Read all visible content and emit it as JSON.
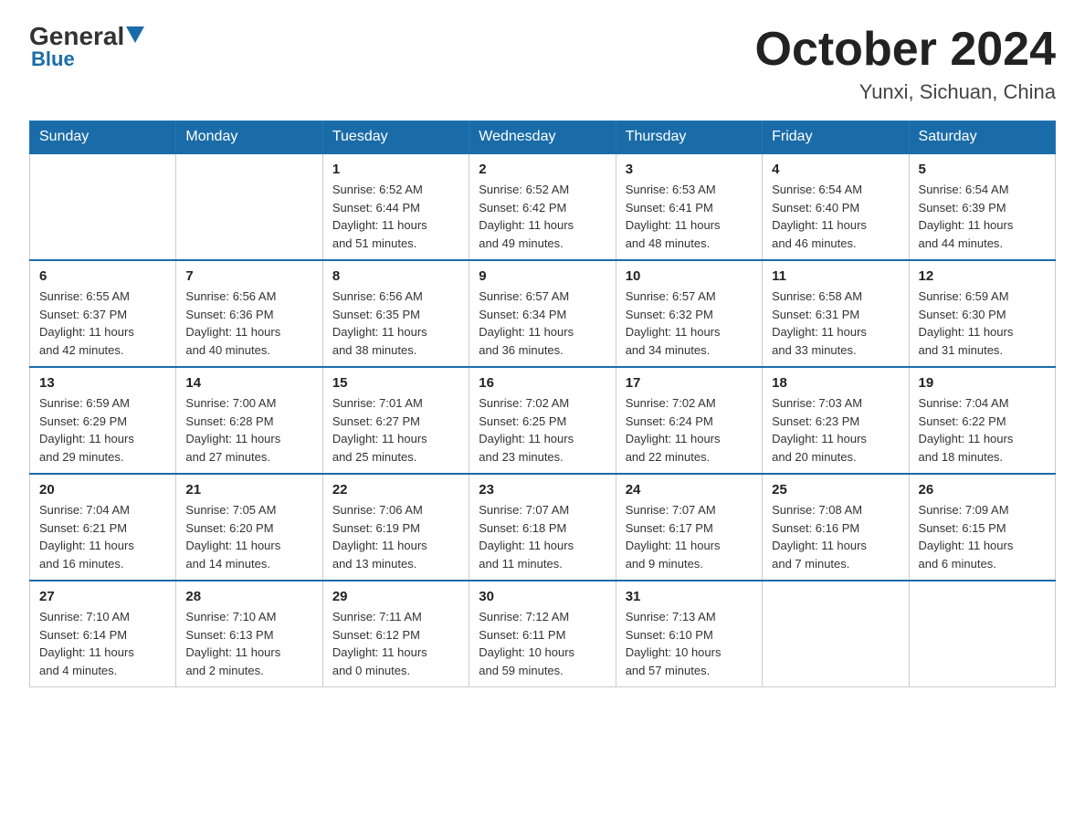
{
  "logo": {
    "general": "General",
    "blue": "Blue"
  },
  "header": {
    "title": "October 2024",
    "subtitle": "Yunxi, Sichuan, China"
  },
  "days": [
    "Sunday",
    "Monday",
    "Tuesday",
    "Wednesday",
    "Thursday",
    "Friday",
    "Saturday"
  ],
  "weeks": [
    [
      {
        "day": "",
        "info": ""
      },
      {
        "day": "",
        "info": ""
      },
      {
        "day": "1",
        "info": "Sunrise: 6:52 AM\nSunset: 6:44 PM\nDaylight: 11 hours\nand 51 minutes."
      },
      {
        "day": "2",
        "info": "Sunrise: 6:52 AM\nSunset: 6:42 PM\nDaylight: 11 hours\nand 49 minutes."
      },
      {
        "day": "3",
        "info": "Sunrise: 6:53 AM\nSunset: 6:41 PM\nDaylight: 11 hours\nand 48 minutes."
      },
      {
        "day": "4",
        "info": "Sunrise: 6:54 AM\nSunset: 6:40 PM\nDaylight: 11 hours\nand 46 minutes."
      },
      {
        "day": "5",
        "info": "Sunrise: 6:54 AM\nSunset: 6:39 PM\nDaylight: 11 hours\nand 44 minutes."
      }
    ],
    [
      {
        "day": "6",
        "info": "Sunrise: 6:55 AM\nSunset: 6:37 PM\nDaylight: 11 hours\nand 42 minutes."
      },
      {
        "day": "7",
        "info": "Sunrise: 6:56 AM\nSunset: 6:36 PM\nDaylight: 11 hours\nand 40 minutes."
      },
      {
        "day": "8",
        "info": "Sunrise: 6:56 AM\nSunset: 6:35 PM\nDaylight: 11 hours\nand 38 minutes."
      },
      {
        "day": "9",
        "info": "Sunrise: 6:57 AM\nSunset: 6:34 PM\nDaylight: 11 hours\nand 36 minutes."
      },
      {
        "day": "10",
        "info": "Sunrise: 6:57 AM\nSunset: 6:32 PM\nDaylight: 11 hours\nand 34 minutes."
      },
      {
        "day": "11",
        "info": "Sunrise: 6:58 AM\nSunset: 6:31 PM\nDaylight: 11 hours\nand 33 minutes."
      },
      {
        "day": "12",
        "info": "Sunrise: 6:59 AM\nSunset: 6:30 PM\nDaylight: 11 hours\nand 31 minutes."
      }
    ],
    [
      {
        "day": "13",
        "info": "Sunrise: 6:59 AM\nSunset: 6:29 PM\nDaylight: 11 hours\nand 29 minutes."
      },
      {
        "day": "14",
        "info": "Sunrise: 7:00 AM\nSunset: 6:28 PM\nDaylight: 11 hours\nand 27 minutes."
      },
      {
        "day": "15",
        "info": "Sunrise: 7:01 AM\nSunset: 6:27 PM\nDaylight: 11 hours\nand 25 minutes."
      },
      {
        "day": "16",
        "info": "Sunrise: 7:02 AM\nSunset: 6:25 PM\nDaylight: 11 hours\nand 23 minutes."
      },
      {
        "day": "17",
        "info": "Sunrise: 7:02 AM\nSunset: 6:24 PM\nDaylight: 11 hours\nand 22 minutes."
      },
      {
        "day": "18",
        "info": "Sunrise: 7:03 AM\nSunset: 6:23 PM\nDaylight: 11 hours\nand 20 minutes."
      },
      {
        "day": "19",
        "info": "Sunrise: 7:04 AM\nSunset: 6:22 PM\nDaylight: 11 hours\nand 18 minutes."
      }
    ],
    [
      {
        "day": "20",
        "info": "Sunrise: 7:04 AM\nSunset: 6:21 PM\nDaylight: 11 hours\nand 16 minutes."
      },
      {
        "day": "21",
        "info": "Sunrise: 7:05 AM\nSunset: 6:20 PM\nDaylight: 11 hours\nand 14 minutes."
      },
      {
        "day": "22",
        "info": "Sunrise: 7:06 AM\nSunset: 6:19 PM\nDaylight: 11 hours\nand 13 minutes."
      },
      {
        "day": "23",
        "info": "Sunrise: 7:07 AM\nSunset: 6:18 PM\nDaylight: 11 hours\nand 11 minutes."
      },
      {
        "day": "24",
        "info": "Sunrise: 7:07 AM\nSunset: 6:17 PM\nDaylight: 11 hours\nand 9 minutes."
      },
      {
        "day": "25",
        "info": "Sunrise: 7:08 AM\nSunset: 6:16 PM\nDaylight: 11 hours\nand 7 minutes."
      },
      {
        "day": "26",
        "info": "Sunrise: 7:09 AM\nSunset: 6:15 PM\nDaylight: 11 hours\nand 6 minutes."
      }
    ],
    [
      {
        "day": "27",
        "info": "Sunrise: 7:10 AM\nSunset: 6:14 PM\nDaylight: 11 hours\nand 4 minutes."
      },
      {
        "day": "28",
        "info": "Sunrise: 7:10 AM\nSunset: 6:13 PM\nDaylight: 11 hours\nand 2 minutes."
      },
      {
        "day": "29",
        "info": "Sunrise: 7:11 AM\nSunset: 6:12 PM\nDaylight: 11 hours\nand 0 minutes."
      },
      {
        "day": "30",
        "info": "Sunrise: 7:12 AM\nSunset: 6:11 PM\nDaylight: 10 hours\nand 59 minutes."
      },
      {
        "day": "31",
        "info": "Sunrise: 7:13 AM\nSunset: 6:10 PM\nDaylight: 10 hours\nand 57 minutes."
      },
      {
        "day": "",
        "info": ""
      },
      {
        "day": "",
        "info": ""
      }
    ]
  ]
}
